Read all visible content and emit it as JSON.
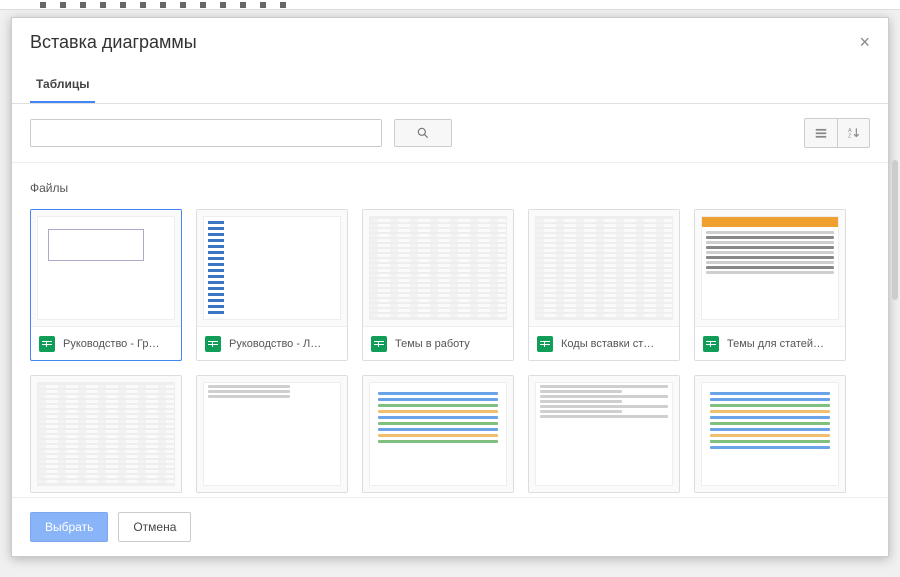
{
  "dialog": {
    "title": "Вставка диаграммы",
    "close": "×",
    "tab_label": "Таблицы",
    "search_placeholder": "",
    "sort_icon_name": "sort-az-icon",
    "section_label": "Файлы",
    "files_row1": [
      {
        "name": "Руководство - Гр…",
        "thumb": "chartish",
        "selected": true
      },
      {
        "name": "Руководство - Л…",
        "thumb": "sidecols",
        "selected": false
      },
      {
        "name": "Темы в работу",
        "thumb": "dense",
        "selected": false
      },
      {
        "name": "Коды вставки ст…",
        "thumb": "dense",
        "selected": false
      },
      {
        "name": "Темы для статей…",
        "thumb": "banner",
        "selected": false
      }
    ],
    "files_row2": [
      {
        "thumb": "dense"
      },
      {
        "thumb": "plainrows"
      },
      {
        "thumb": "grid-rows"
      },
      {
        "thumb": "plainrows"
      },
      {
        "thumb": "grid-rows"
      }
    ],
    "footer": {
      "select": "Выбрать",
      "cancel": "Отмена"
    }
  }
}
